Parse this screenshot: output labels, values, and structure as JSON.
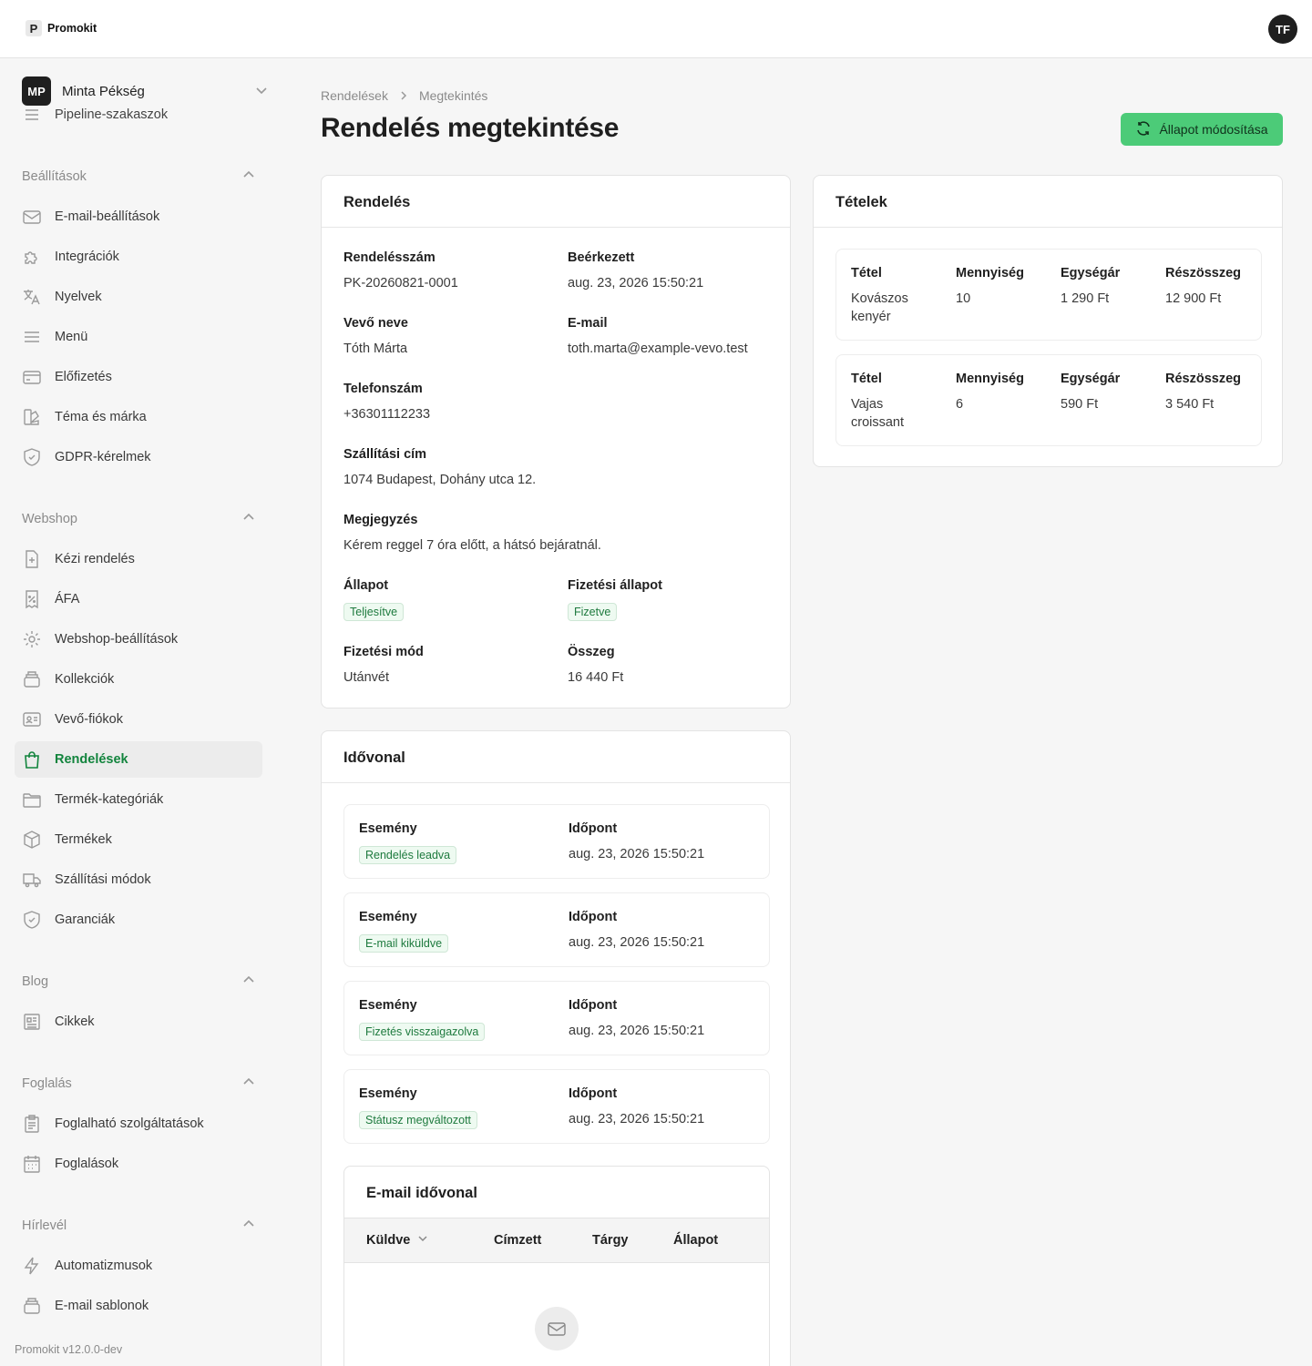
{
  "app": {
    "name": "Promokit",
    "logo_letter": "P",
    "user_initials": "TF",
    "version": "Promokit v12.0.0-dev"
  },
  "org": {
    "initials": "MP",
    "name": "Minta Pékség"
  },
  "sidebar": {
    "partial_item": "Pipeline-szakaszok",
    "sections": [
      {
        "title": "Beállítások",
        "items": [
          {
            "label": "E-mail-beállítások",
            "icon": "mail-icon"
          },
          {
            "label": "Integrációk",
            "icon": "puzzle-icon"
          },
          {
            "label": "Nyelvek",
            "icon": "translate-icon"
          },
          {
            "label": "Menü",
            "icon": "menu-icon"
          },
          {
            "label": "Előfizetés",
            "icon": "credit-card-icon"
          },
          {
            "label": "Téma és márka",
            "icon": "palette-icon"
          },
          {
            "label": "GDPR-kérelmek",
            "icon": "shield-icon"
          }
        ]
      },
      {
        "title": "Webshop",
        "items": [
          {
            "label": "Kézi rendelés",
            "icon": "file-plus-icon"
          },
          {
            "label": "ÁFA",
            "icon": "receipt-percent-icon"
          },
          {
            "label": "Webshop-beállítások",
            "icon": "gear-icon"
          },
          {
            "label": "Kollekciók",
            "icon": "stack-icon"
          },
          {
            "label": "Vevő-fiókok",
            "icon": "id-card-icon"
          },
          {
            "label": "Rendelések",
            "icon": "shopping-bag-icon",
            "active": true
          },
          {
            "label": "Termék-kategóriák",
            "icon": "folder-icon"
          },
          {
            "label": "Termékek",
            "icon": "box-icon"
          },
          {
            "label": "Szállítási módok",
            "icon": "truck-icon"
          },
          {
            "label": "Garanciák",
            "icon": "shield-check-icon"
          }
        ]
      },
      {
        "title": "Blog",
        "items": [
          {
            "label": "Cikkek",
            "icon": "newspaper-icon"
          }
        ]
      },
      {
        "title": "Foglalás",
        "items": [
          {
            "label": "Foglalható szolgáltatások",
            "icon": "clipboard-icon"
          },
          {
            "label": "Foglalások",
            "icon": "calendar-icon"
          }
        ]
      },
      {
        "title": "Hírlevél",
        "items": [
          {
            "label": "Automatizmusok",
            "icon": "lightning-icon"
          },
          {
            "label": "E-mail sablonok",
            "icon": "stack-icon"
          }
        ]
      }
    ]
  },
  "breadcrumb": {
    "parent": "Rendelések",
    "current": "Megtekintés"
  },
  "page": {
    "title": "Rendelés megtekintése",
    "status_button": "Állapot módosítása"
  },
  "order": {
    "title": "Rendelés",
    "number_label": "Rendelésszám",
    "number": "PK-20260821-0001",
    "received_label": "Beérkezett",
    "received": "aug. 23, 2026 15:50:21",
    "customer_label": "Vevő neve",
    "customer": "Tóth Márta",
    "email_label": "E-mail",
    "email": "toth.marta@example-vevo.test",
    "phone_label": "Telefonszám",
    "phone": "+36301112233",
    "address_label": "Szállítási cím",
    "address": "1074 Budapest, Dohány utca 12.",
    "note_label": "Megjegyzés",
    "note": "Kérem reggel 7 óra előtt, a hátsó bejáratnál.",
    "status_label": "Állapot",
    "status": "Teljesítve",
    "payment_status_label": "Fizetési állapot",
    "payment_status": "Fizetve",
    "payment_method_label": "Fizetési mód",
    "payment_method": "Utánvét",
    "total_label": "Összeg",
    "total": "16 440 Ft"
  },
  "items": {
    "title": "Tételek",
    "headers": {
      "item": "Tétel",
      "qty": "Mennyiség",
      "unit": "Egységár",
      "subtotal": "Részösszeg"
    },
    "rows": [
      {
        "name_line1": "Kovászos",
        "name_line2": "kenyér",
        "qty": "10",
        "unit": "1 290 Ft",
        "subtotal": "12 900 Ft"
      },
      {
        "name_line1": "Vajas",
        "name_line2": "croissant",
        "qty": "6",
        "unit": "590 Ft",
        "subtotal": "3 540 Ft"
      }
    ]
  },
  "timeline": {
    "title": "Idővonal",
    "event_label": "Esemény",
    "time_label": "Időpont",
    "events": [
      {
        "event": "Rendelés leadva",
        "time": "aug. 23, 2026 15:50:21"
      },
      {
        "event": "E-mail kiküldve",
        "time": "aug. 23, 2026 15:50:21"
      },
      {
        "event": "Fizetés visszaigazolva",
        "time": "aug. 23, 2026 15:50:21"
      },
      {
        "event": "Státusz megváltozott",
        "time": "aug. 23, 2026 15:50:21"
      }
    ]
  },
  "email_timeline": {
    "title": "E-mail idővonal",
    "columns": {
      "sent": "Küldve",
      "recipient": "Címzett",
      "subject": "Tárgy",
      "status": "Állapot"
    }
  },
  "colors": {
    "accent_green": "#12843d",
    "button_green": "#4ccb78",
    "badge_bg": "#eefaf1"
  }
}
